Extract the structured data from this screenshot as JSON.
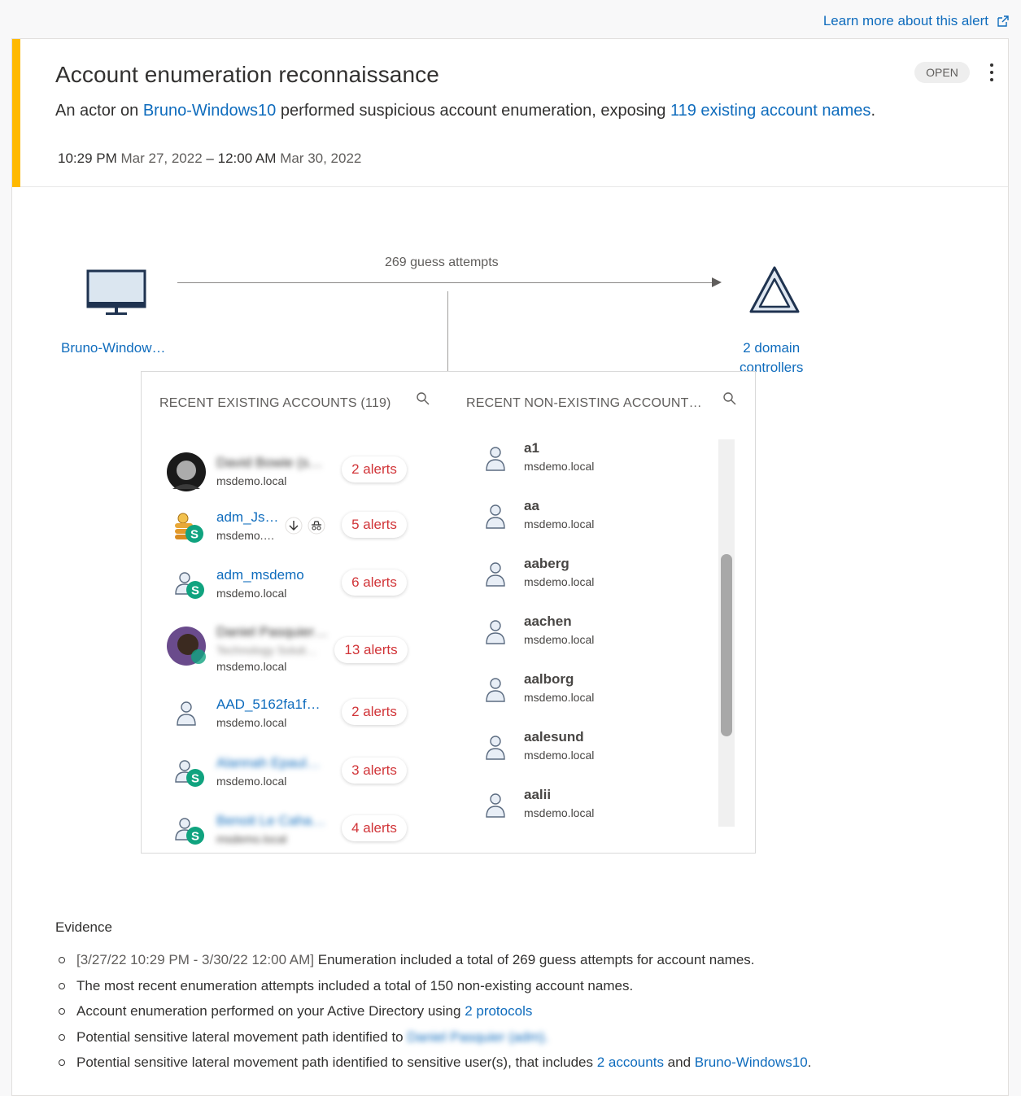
{
  "learn_more": "Learn more about this alert",
  "header": {
    "title": "Account enumeration reconnaissance",
    "desc_prefix": "An actor on ",
    "desc_host": "Bruno-Windows10",
    "desc_middle": " performed suspicious account enumeration, exposing ",
    "desc_accounts": "119 existing account names",
    "desc_suffix": ".",
    "start_time": "10:29 PM",
    "start_date": "Mar 27, 2022",
    "separator": "–",
    "end_time": "12:00 AM",
    "end_date": "Mar 30, 2022",
    "status": "OPEN",
    "severity_color": "#ffb900"
  },
  "diagram": {
    "source_label": "Bruno-Window…",
    "arrow_label": "269 guess attempts",
    "target_label_line1": "2 domain",
    "target_label_line2": "controllers",
    "existing_header": "RECENT EXISTING ACCOUNTS (119)",
    "nonexisting_header": "RECENT NON-EXISTING ACCOUNT…"
  },
  "existing_accounts": [
    {
      "name": "David Bowie (s…",
      "domain": "msdemo.local",
      "alerts": "2 alerts",
      "blurred": true
    },
    {
      "name": "adm_Js…",
      "domain": "msdemo.…",
      "alerts": "5 alerts",
      "blurred": false
    },
    {
      "name": "adm_msdemo",
      "domain": "msdemo.local",
      "alerts": "6 alerts",
      "blurred": false
    },
    {
      "name": "Daniel Pasquier…",
      "subtitle": "Technology Soluti…",
      "domain": "msdemo.local",
      "alerts": "13 alerts",
      "blurred": true
    },
    {
      "name": "AAD_5162fa1f…",
      "domain": "msdemo.local",
      "alerts": "2 alerts",
      "blurred": false
    },
    {
      "name": "Alannah Epaul…",
      "domain": "msdemo.local",
      "alerts": "3 alerts",
      "blurred": true
    },
    {
      "name": "Benoit Le Caha…",
      "domain": "msdemo.local",
      "alerts": "4 alerts",
      "blurred": true
    }
  ],
  "nonexisting_accounts": [
    {
      "name": "a1",
      "domain": "msdemo.local"
    },
    {
      "name": "aa",
      "domain": "msdemo.local"
    },
    {
      "name": "aaberg",
      "domain": "msdemo.local"
    },
    {
      "name": "aachen",
      "domain": "msdemo.local"
    },
    {
      "name": "aalborg",
      "domain": "msdemo.local"
    },
    {
      "name": "aalesund",
      "domain": "msdemo.local"
    },
    {
      "name": "aalii",
      "domain": "msdemo.local"
    }
  ],
  "evidence": {
    "title": "Evidence",
    "item1_time": "[3/27/22 10:29 PM - 3/30/22 12:00 AM]",
    "item1_text": " Enumeration included a total of 269 guess attempts for account names.",
    "item2_text": "The most recent enumeration attempts included a total of 150 non-existing account names.",
    "item3_text": "Account enumeration performed on your Active Directory using ",
    "item3_link": "2 protocols",
    "item4_text": "Potential sensitive lateral movement path identified to ",
    "item4_link": "Daniel Pasquier (adm).",
    "item5_text": "Potential sensitive lateral movement path identified to sensitive user(s), that includes ",
    "item5_link1": "2 accounts",
    "item5_mid": " and ",
    "item5_link2": "Bruno-Windows10",
    "item5_end": "."
  }
}
